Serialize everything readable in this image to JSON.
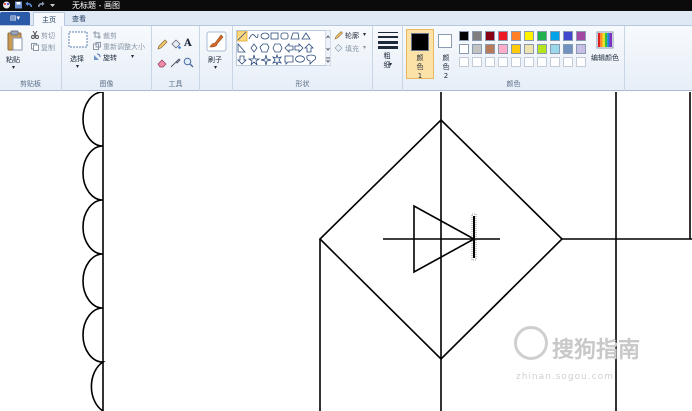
{
  "window": {
    "title": "无标题 - 画图"
  },
  "tabs": {
    "file": "▤▾",
    "home": "主页",
    "view": "查看"
  },
  "clipboard": {
    "paste": "粘贴",
    "cut": "剪切",
    "copy": "复制",
    "group": "剪贴板"
  },
  "image": {
    "select": "选择",
    "crop": "裁剪",
    "resize": "重新调整大小",
    "rotate": "旋转",
    "group": "图像"
  },
  "tools": {
    "group": "工具",
    "text_tool": "A"
  },
  "brushes": {
    "label": "刷子"
  },
  "shapes": {
    "outline": "轮廓",
    "fill": "填充",
    "group": "形状"
  },
  "size": {
    "label": "粗细"
  },
  "colors": {
    "color1": "颜色 1",
    "color2": "颜色 2",
    "edit": "编辑颜色",
    "group": "颜色",
    "color1_value": "#000000",
    "color2_value": "#ffffff",
    "palette_row1": [
      "#000000",
      "#7f7f7f",
      "#880015",
      "#ed1c24",
      "#ff7f27",
      "#fff200",
      "#22b14c",
      "#00a2e8",
      "#3f48cc",
      "#a349a4"
    ],
    "palette_row2": [
      "#ffffff",
      "#c3c3c3",
      "#b97a57",
      "#ffaec9",
      "#ffc90e",
      "#efe4b0",
      "#b5e61d",
      "#99d9ea",
      "#7092be",
      "#c8bfe7"
    ]
  },
  "watermark": {
    "text": "搜狗指南",
    "url": "zhinan.sogou.com"
  }
}
